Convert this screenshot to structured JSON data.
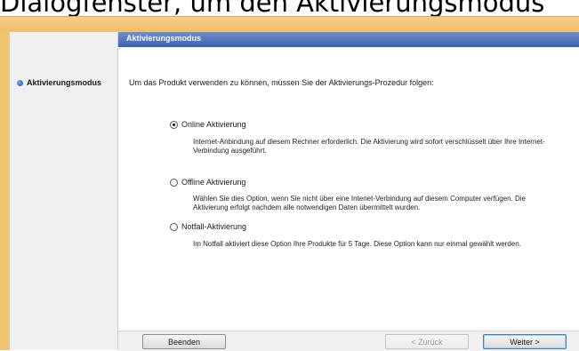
{
  "caption": "Dialogfenster, um den Aktivierungsmodus",
  "sidebar": {
    "items": [
      {
        "label": "Aktivierungsmodus",
        "active": true
      }
    ]
  },
  "dialog": {
    "title": "Aktivierungsmodus",
    "intro": "Um das Produkt verwenden zu können, müssen Sie der Aktivierungs-Prozedur folgen:",
    "options": [
      {
        "label": "Online Aktivierung",
        "selected": true,
        "description": "Internet-Anbindung auf diesem Rechner erforderlich. Die Aktivierung wird sofort verschlüsselt über Ihre Internet-Verbindung ausgeführt."
      },
      {
        "label": "Offline Aktivierung",
        "selected": false,
        "description": "Wählen Sie dies Option, wenn Sie nicht über eine  Intenet-Verbindung auf diesem Computer verfügen. Die Aktivierung erfolgt nachdem alle notwendigen Daten übermittelt wurden."
      },
      {
        "label": "Notfall-Aktivierung",
        "selected": false,
        "description": "Im Notfall aktiviert diese Option Ihre Produkte für 5 Tage. Diese Option kann nur einmal gewählt werden."
      }
    ]
  },
  "buttons": {
    "quit": "Beenden",
    "back": "< Zurück",
    "next": "Weiter >"
  },
  "colors": {
    "frame": "#f2c570",
    "title_bar": "#4a6db5",
    "sidebar_bg": "#f0f0f0"
  }
}
